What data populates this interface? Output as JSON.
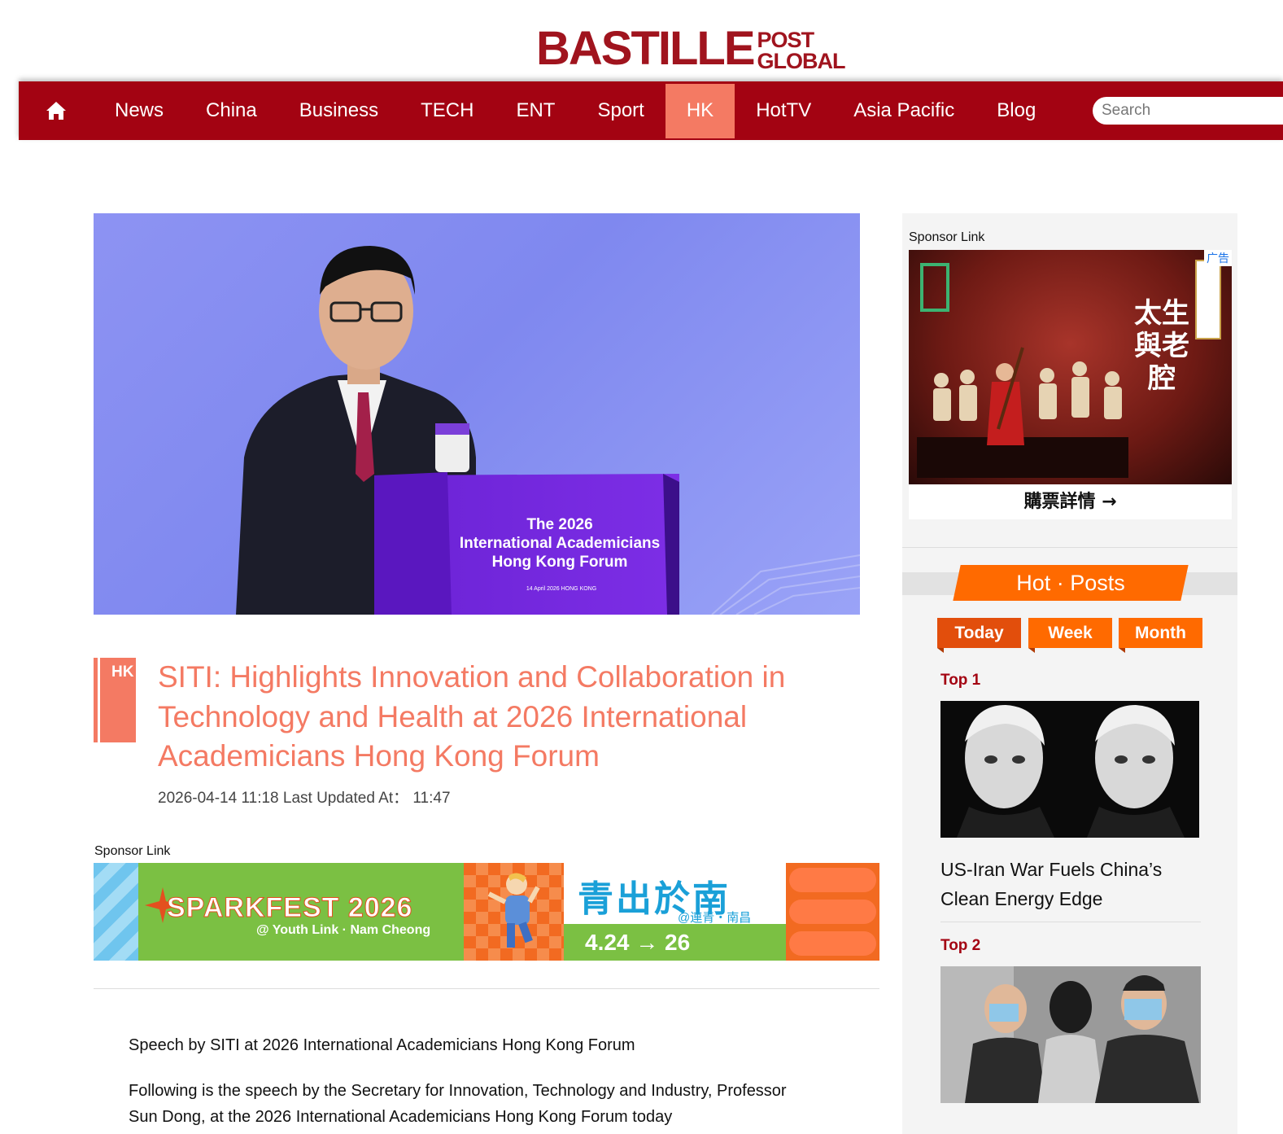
{
  "logo": {
    "main": "BASTILLE",
    "post": "POST",
    "global": "GLOBAL"
  },
  "nav": {
    "items": [
      "News",
      "China",
      "Business",
      "TECH",
      "ENT",
      "Sport",
      "HK",
      "HotTV",
      "Asia Pacific",
      "Blog"
    ],
    "active": "HK",
    "search_placeholder": "Search"
  },
  "hero": {
    "podium_line1": "The 2026",
    "podium_line2": "International Academicians",
    "podium_line3": "Hong Kong Forum",
    "podium_small": "14 April 2026   HONG KONG"
  },
  "article": {
    "tag": "HK",
    "title": "SITI: Highlights Innovation and Collaboration in Technology and Health at 2026 International Academicians Hong Kong Forum",
    "meta": "2026-04-14 11:18 Last Updated At：  11:47",
    "sponsor_label": "Sponsor Link",
    "p1": "Speech by SITI at 2026 International Academicians Hong Kong Forum",
    "p2": "Following is the speech by the Secretary for Innovation, Technology and Industry, Professor Sun Dong, at the 2026 International Academicians Hong Kong Forum today"
  },
  "banner": {
    "name": "SPARKFEST 2026",
    "sub": "@ Youth Link · Nam Cheong",
    "zh": "青出於南",
    "loc": "@連青・南昌",
    "dates": "4.24 → 26"
  },
  "sidebar": {
    "sponsor_label": "Sponsor Link",
    "ad_badge": "广告",
    "ad_title": "太生與老腔",
    "ad_cta": "購票詳情 →",
    "hot_title": "Hot · Posts",
    "tabs": [
      "Today",
      "Week",
      "Month"
    ],
    "active_tab": "Today",
    "posts": [
      {
        "rank": "Top 1",
        "title": "US-Iran War Fuels China’s Clean Energy Edge"
      },
      {
        "rank": "Top 2",
        "title": ""
      }
    ]
  },
  "colors": {
    "brand": "#a30312",
    "accent": "#f47a63",
    "hot": "#ff6a00"
  }
}
